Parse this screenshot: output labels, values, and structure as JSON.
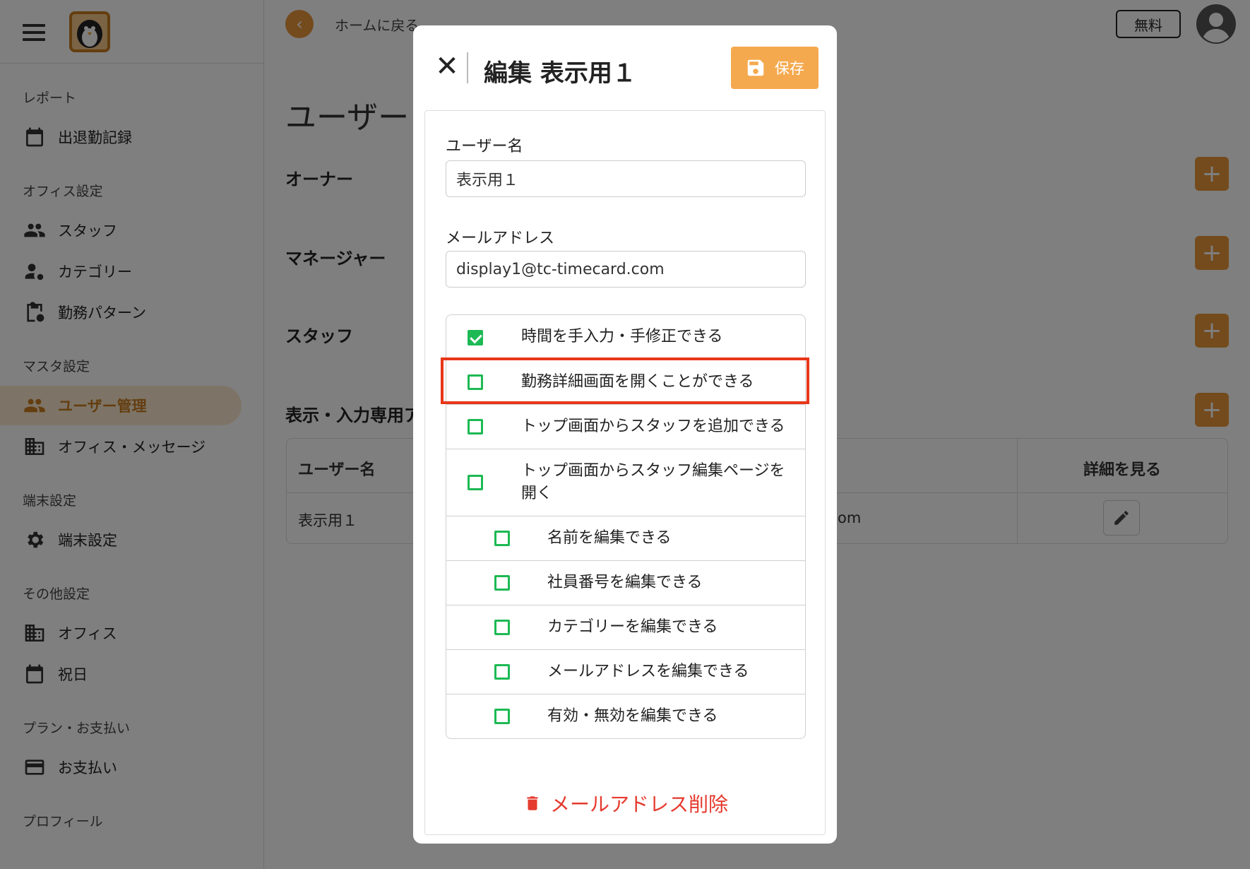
{
  "sidebar": {
    "sections": [
      {
        "label": "レポート",
        "items": [
          {
            "label": "出退勤記録",
            "icon": "calendar-icon"
          }
        ]
      },
      {
        "label": "オフィス設定",
        "items": [
          {
            "label": "スタッフ",
            "icon": "people-icon"
          },
          {
            "label": "カテゴリー",
            "icon": "person-gear-icon"
          },
          {
            "label": "勤務パターン",
            "icon": "clipboard-clock-icon"
          }
        ]
      },
      {
        "label": "マスタ設定",
        "items": [
          {
            "label": "ユーザー管理",
            "icon": "people-icon",
            "active": true
          },
          {
            "label": "オフィス・メッセージ",
            "icon": "building-icon"
          }
        ]
      },
      {
        "label": "端末設定",
        "items": [
          {
            "label": "端末設定",
            "icon": "gear-icon"
          }
        ]
      },
      {
        "label": "その他設定",
        "items": [
          {
            "label": "オフィス",
            "icon": "building-icon"
          },
          {
            "label": "祝日",
            "icon": "calendar-icon"
          }
        ]
      },
      {
        "label": "プラン・お支払い",
        "items": [
          {
            "label": "お支払い",
            "icon": "credit-card-icon"
          }
        ]
      },
      {
        "label": "プロフィール",
        "items": []
      }
    ]
  },
  "topbar": {
    "back_label": "ホームに戻る",
    "plan_badge": "無料"
  },
  "main": {
    "page_title": "ユーザー",
    "sections": [
      "オーナー",
      "マネージャー",
      "スタッフ",
      "表示・入力専用ア"
    ],
    "table": {
      "headers": [
        "ユーザー名",
        "詳細を見る"
      ],
      "rows": [
        {
          "name": "表示用１",
          "email_tail": "om"
        }
      ]
    }
  },
  "modal": {
    "title": "編集 表示用１",
    "save_label": "保存",
    "username_label": "ユーザー名",
    "username_value": "表示用１",
    "email_label": "メールアドレス",
    "email_value": "display1@tc-timecard.com",
    "permissions": [
      {
        "label": "時間を手入力・手修正できる",
        "checked": true,
        "indent": 0
      },
      {
        "label": "勤務詳細画面を開くことができる",
        "checked": false,
        "indent": 0,
        "highlighted": true
      },
      {
        "label": "トップ画面からスタッフを追加できる",
        "checked": false,
        "indent": 0
      },
      {
        "label": "トップ画面からスタッフ編集ページを開く",
        "checked": false,
        "indent": 0
      },
      {
        "label": "名前を編集できる",
        "checked": false,
        "indent": 1
      },
      {
        "label": "社員番号を編集できる",
        "checked": false,
        "indent": 1
      },
      {
        "label": "カテゴリーを編集できる",
        "checked": false,
        "indent": 1
      },
      {
        "label": "メールアドレスを編集できる",
        "checked": false,
        "indent": 1
      },
      {
        "label": "有効・無効を編集できる",
        "checked": false,
        "indent": 1
      }
    ],
    "delete_label": "メールアドレス削除"
  },
  "colors": {
    "accent": "#e8973a",
    "checkbox": "#1db954",
    "highlight": "#e8361a",
    "danger": "#e53a2e"
  }
}
